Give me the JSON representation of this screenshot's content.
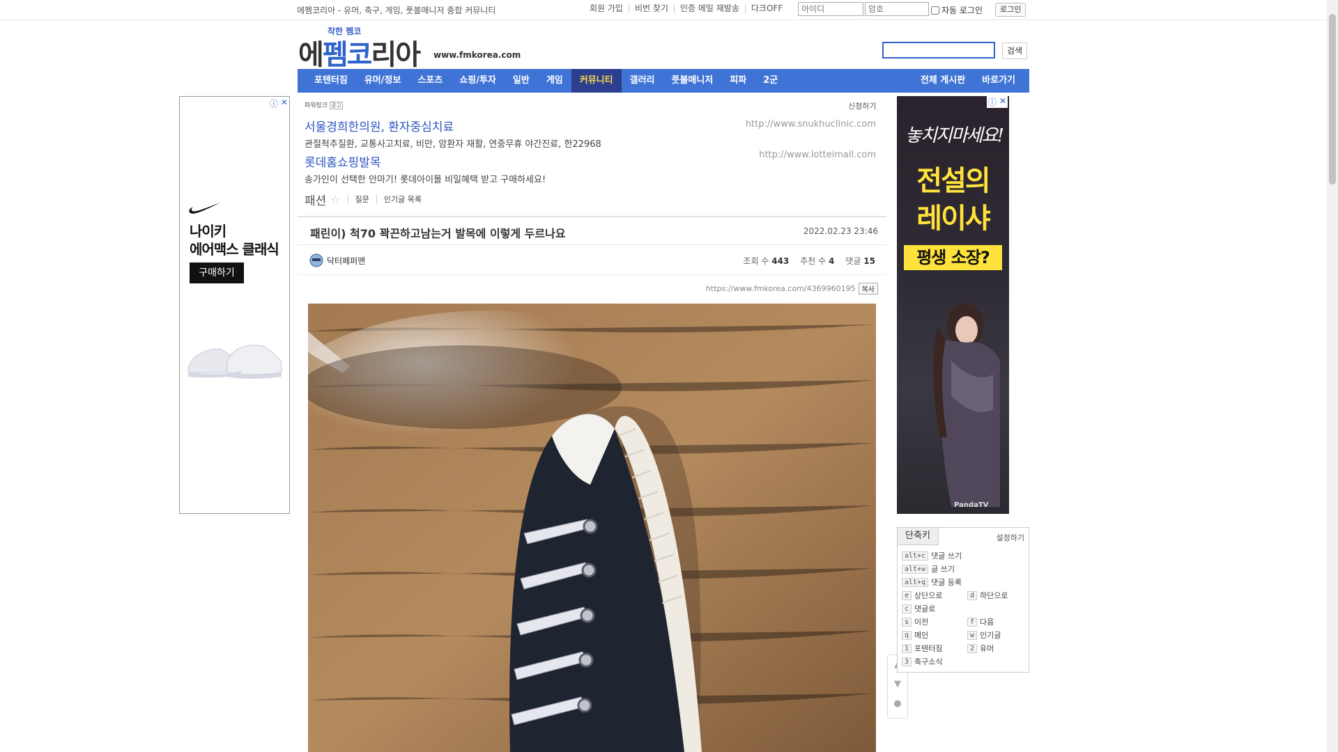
{
  "topbar": {
    "tagline": "에펨코리아 - 유머, 축구, 게임, 풋볼매니저 종합 커뮤니티",
    "links": [
      "회원 가입",
      "비번 찾기",
      "인증 메일 재발송",
      "다크OFF"
    ],
    "id_placeholder": "아이디",
    "pw_placeholder": "암호",
    "auto_login": "자동 로그인",
    "login_button": "로그인"
  },
  "logo": {
    "small": "착한 펨코",
    "big_a": "에",
    "big_b": "펨코",
    "big_c": "리아",
    "url": "www.fmkorea.com"
  },
  "search": {
    "button": "검색",
    "value": ""
  },
  "nav": {
    "items": [
      "포텐터짐",
      "유머/정보",
      "스포츠",
      "쇼핑/투자",
      "일반",
      "게임",
      "커뮤니티",
      "갤러리",
      "풋볼매니저",
      "피파",
      "2군"
    ],
    "active_index": 6,
    "right": [
      "전체 게시판",
      "바로가기"
    ]
  },
  "ad_left": {
    "brand": "나이키",
    "product": "에어맥스 클래식",
    "cta": "구매하기"
  },
  "ad_right": {
    "script": "놓치지마세요!",
    "line1": "전설의",
    "line2": "레이샤",
    "box": "평생 소장?",
    "logo": "PandaTV"
  },
  "powerlink": {
    "label": "파워링크",
    "badge": "광고",
    "apply": "신청하기",
    "ads": [
      {
        "title": "서울경희한의원, 환자중심치료",
        "desc": "관절척추질환, 교통사고치료, 비만, 암환자 재활, 연중무휴 야간진료, 한22968",
        "url": "http://www.snukhuclinic.com"
      },
      {
        "title": "롯데홈쇼핑발목",
        "desc": "송가인이 선택한 안마기! 롯데아이몰 비밀혜택 받고 구매하세요!",
        "url": "http://www.lotteimall.com"
      }
    ]
  },
  "board": {
    "name": "패션",
    "sub1": "질문",
    "sub2": "인기글 목록"
  },
  "post": {
    "title": "패린이) 척70 꽉끈하고남는거 발목에 이렇게 두르나요",
    "date": "2022.02.23 23:46",
    "author": "닥터페퍼맨",
    "views_label": "조회 수",
    "views": "443",
    "recommend_label": "추천 수",
    "recommend": "4",
    "comments_label": "댓글",
    "comments": "15",
    "url": "https://www.fmkorea.com/4369960195",
    "copy": "복사"
  },
  "shortcut": {
    "tab": "단축키",
    "setting": "설정하기",
    "items": [
      {
        "key": "alt+c",
        "label": "댓글 쓰기"
      },
      {
        "key": "alt+w",
        "label": "글 쓰기"
      },
      {
        "key": "alt+q",
        "label": "댓글 등록"
      },
      {
        "key": "e",
        "label": "상단으로"
      },
      {
        "key": "d",
        "label": "하단으로"
      },
      {
        "key": "c",
        "label": "댓글로"
      },
      {
        "key": "s",
        "label": "이전"
      },
      {
        "key": "f",
        "label": "다음"
      },
      {
        "key": "q",
        "label": "메인"
      },
      {
        "key": "w",
        "label": "인기글"
      },
      {
        "key": "1",
        "label": "포텐터짐"
      },
      {
        "key": "2",
        "label": "유머"
      },
      {
        "key": "3",
        "label": "축구소식"
      }
    ]
  },
  "colors": {
    "nav_bg": "#3f74d6",
    "nav_active_bg": "#2b3f8e",
    "nav_active_text": "#ffd84d",
    "ad_title": "#2a55c0"
  }
}
